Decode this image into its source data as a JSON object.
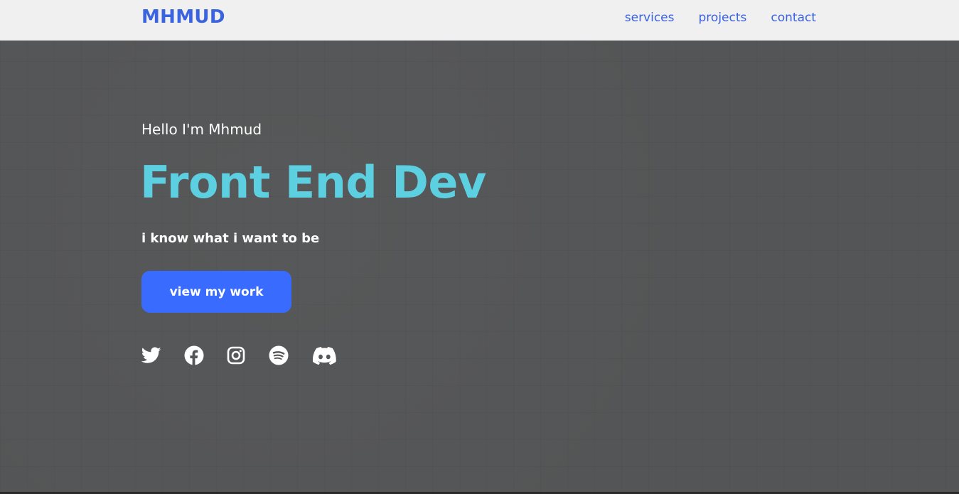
{
  "header": {
    "logo": "MHMUD",
    "nav": [
      {
        "label": "services"
      },
      {
        "label": "projects"
      },
      {
        "label": "contact"
      }
    ]
  },
  "hero": {
    "greeting": "Hello I'm Mhmud",
    "headline": "Front End Dev",
    "tagline": "i know what i want to be",
    "cta_label": "view my work",
    "socials": [
      "twitter-icon",
      "facebook-icon",
      "instagram-icon",
      "spotify-icon",
      "discord-icon"
    ]
  },
  "colors": {
    "navbar_bg": "#f0f0f0",
    "brand_blue": "#3a63e0",
    "hero_bg": "#545556",
    "headline": "#5ccfe0",
    "button": "#3a6bff",
    "text": "#ffffff"
  }
}
